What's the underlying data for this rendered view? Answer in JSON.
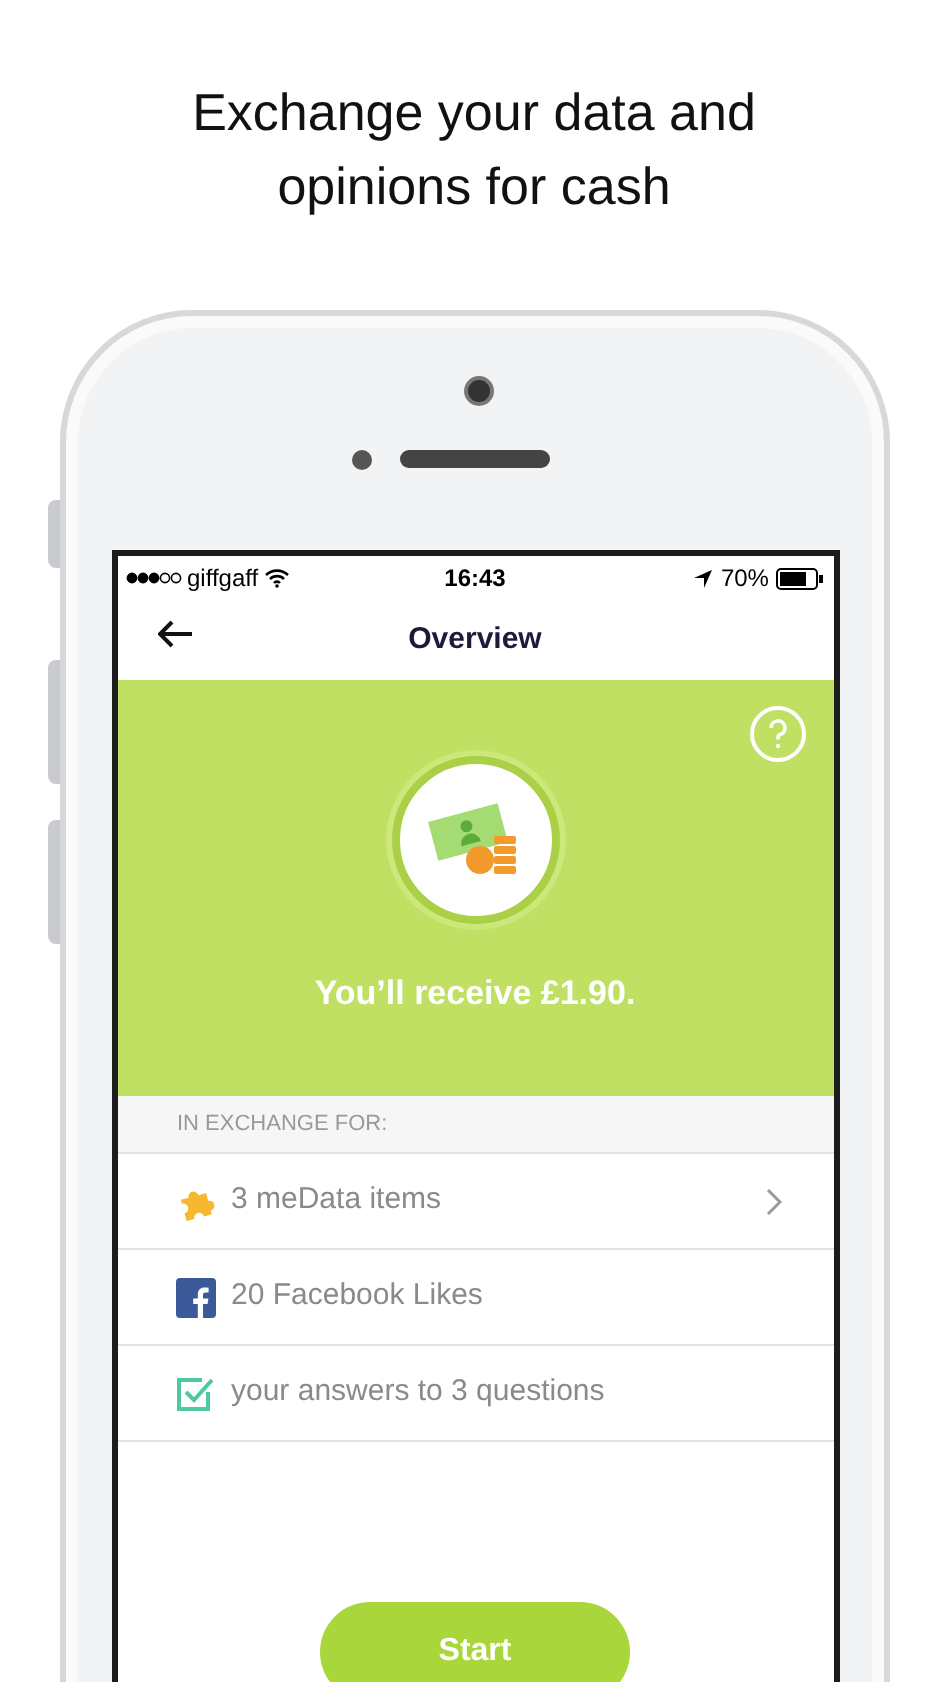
{
  "headline": "Exchange your data and opinions for cash",
  "status_bar": {
    "carrier": "giffgaff",
    "time": "16:43",
    "battery": "70%"
  },
  "nav": {
    "title": "Overview"
  },
  "reward": {
    "text": "You’ll receive £1.90."
  },
  "exchange": {
    "header": "IN EXCHANGE FOR:",
    "items": [
      {
        "kind": "puzzle",
        "label": "3 meData items",
        "chevron": true
      },
      {
        "kind": "facebook",
        "label": "20 Facebook Likes",
        "chevron": false
      },
      {
        "kind": "checkbox",
        "label": "your answers to 3 questions",
        "chevron": false
      }
    ]
  },
  "start_button": {
    "label": "Start"
  }
}
